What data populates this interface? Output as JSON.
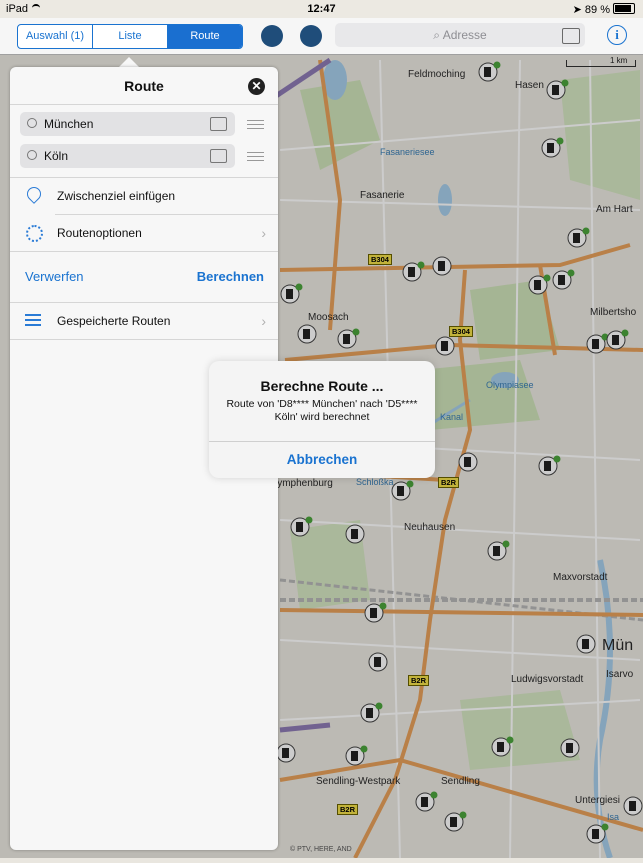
{
  "status_bar": {
    "device": "iPad",
    "time": "12:47",
    "battery": "89 %"
  },
  "toolbar": {
    "segments": [
      "Auswahl (1)",
      "Liste",
      "Route"
    ],
    "selected_segment": "Route",
    "search_placeholder": "Adresse"
  },
  "map": {
    "scale_label": "1 km",
    "copyright": "© PTV, HERE, AND",
    "labels": [
      "Feldmoching",
      "Hasen",
      "Fasaneriesee",
      "Fasanerie",
      "Am Hart",
      "Moosach",
      "Milbertsho",
      "Olympiasee",
      "Kanal",
      "Schloßka",
      "Nymphenburg",
      "Neuhausen",
      "Maxvorstadt",
      "Mün",
      "Isarvo",
      "Ludwigsvorstadt",
      "Sendling-Westpark",
      "Sendling",
      "Untergiesi",
      "Isa"
    ],
    "road_tags": [
      "B304",
      "B304",
      "B2R",
      "B2R",
      "B2R"
    ]
  },
  "route_panel": {
    "title": "Route",
    "origin": "München",
    "destination": "Köln",
    "add_waypoint": "Zwischenziel einfügen",
    "route_options": "Routenoptionen",
    "discard": "Verwerfen",
    "calculate": "Berechnen",
    "saved_routes": "Gespeicherte Routen"
  },
  "alert": {
    "title": "Berechne Route ...",
    "message": "Route von 'D8**** München' nach 'D5**** Köln' wird berechnet",
    "cancel": "Abbrechen"
  },
  "colors": {
    "accent": "#1a73d0",
    "road": "#e8a15a",
    "water": "#9ec9ea",
    "park": "#c8dfb0"
  }
}
